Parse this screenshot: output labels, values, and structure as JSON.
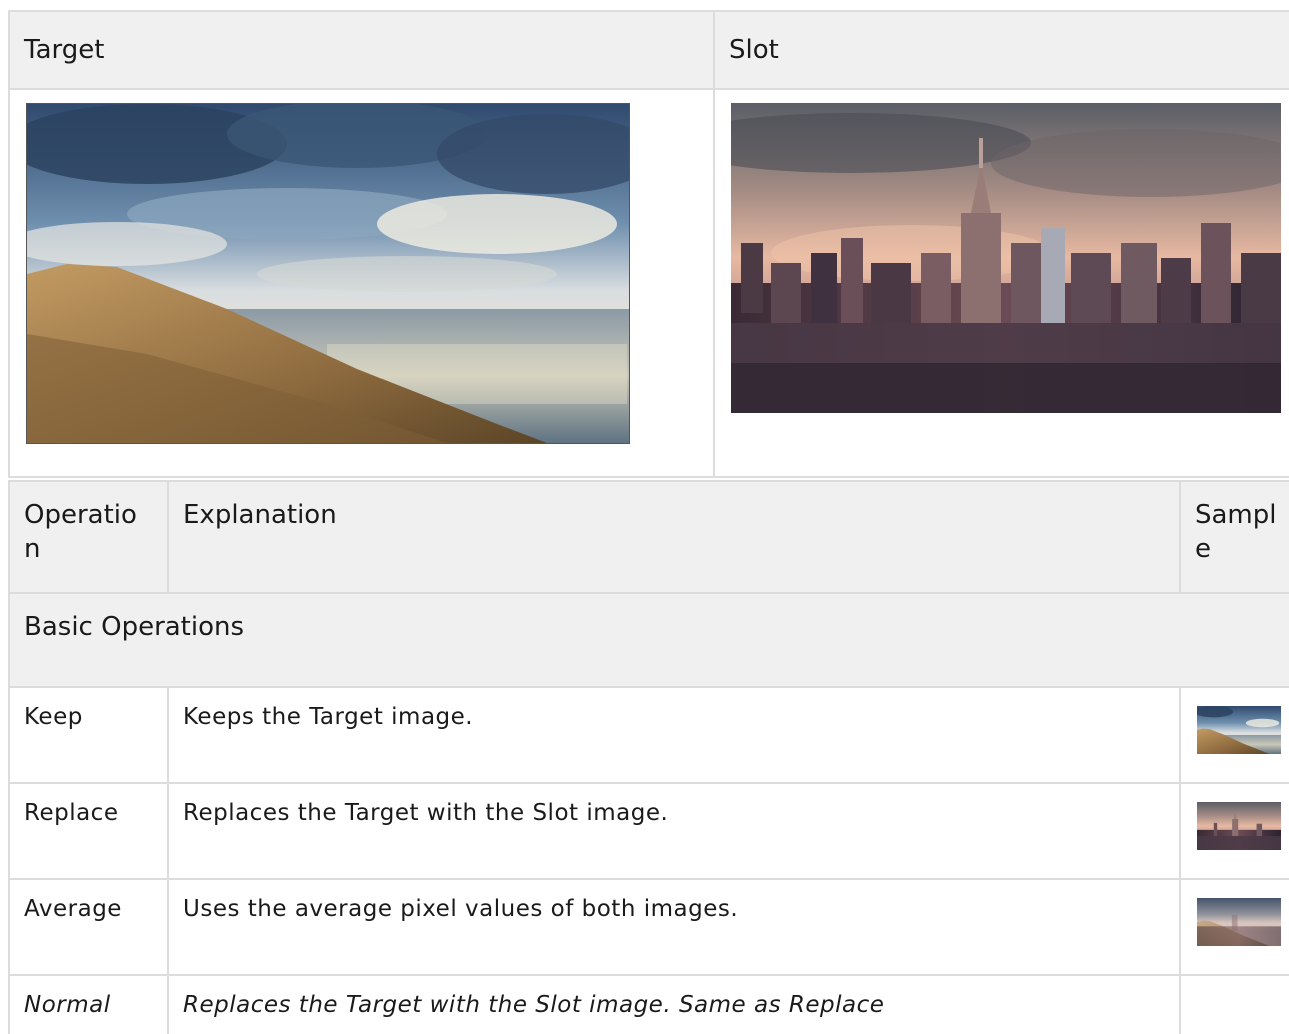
{
  "top_table": {
    "headers": [
      "Target",
      "Slot"
    ],
    "target_image": {
      "name": "target-image",
      "alt": "sand-dune-ocean-photo"
    },
    "slot_image": {
      "name": "slot-image",
      "alt": "city-skyline-photo"
    }
  },
  "ops_table": {
    "headers": [
      "Operation",
      "Explanation",
      "Sample"
    ],
    "sections": [
      {
        "title": "Basic Operations",
        "rows": [
          {
            "operation": "Keep",
            "explanation": "Keeps the Target image.",
            "sample": "target"
          },
          {
            "operation": "Replace",
            "explanation": "Replaces the Target with the Slot image.",
            "sample": "slot"
          },
          {
            "operation": "Average",
            "explanation": "Uses the average pixel values of both images.",
            "sample": "average"
          },
          {
            "operation": "Normal",
            "explanation": "Replaces the Target with the Slot image. Same as Replace",
            "sample": ""
          }
        ]
      }
    ]
  }
}
